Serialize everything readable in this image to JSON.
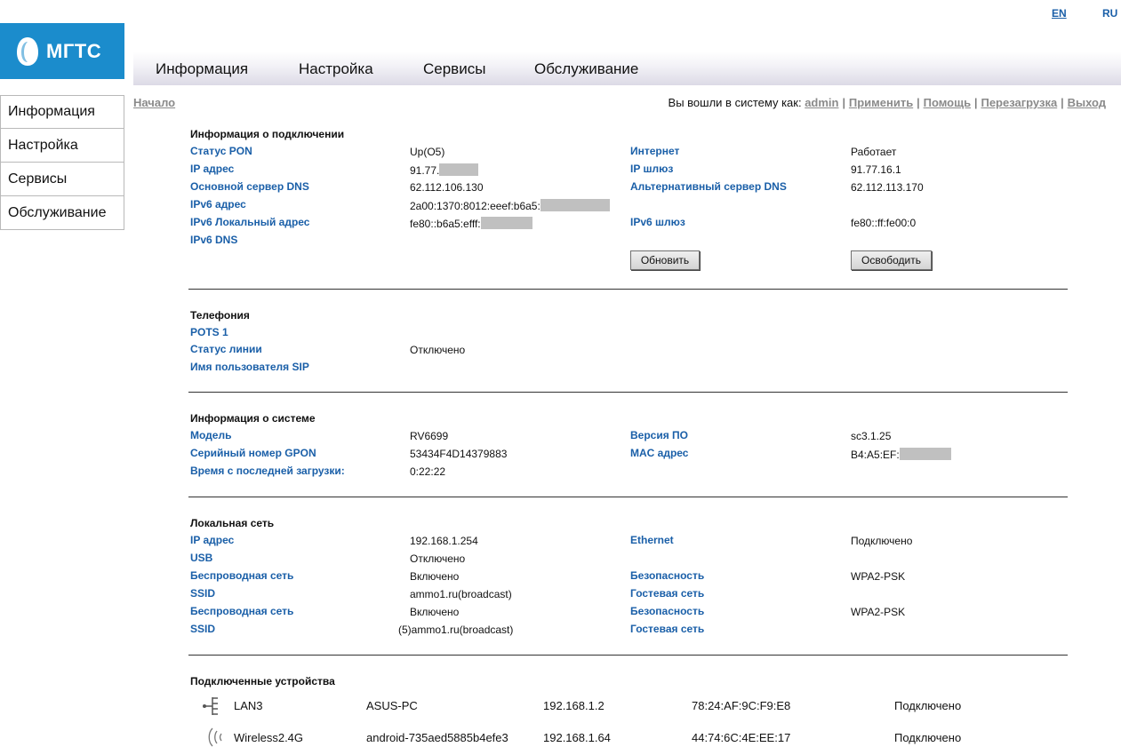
{
  "lang": {
    "en": "EN",
    "ru": "RU"
  },
  "logo": {
    "text": "МГТС",
    "color": "#1b8ccc"
  },
  "topnav": [
    "Информация",
    "Настройка",
    "Сервисы",
    "Обслуживание"
  ],
  "sidebar": [
    "Информация",
    "Настройка",
    "Сервисы",
    "Обслуживание"
  ],
  "breadcrumb": "Начало",
  "userbar": {
    "logged_in_as": "Вы вошли в систему как:",
    "user": "admin",
    "apply": "Применить",
    "help": "Помощь",
    "reboot": "Перезагрузка",
    "logout": "Выход"
  },
  "connection": {
    "title": "Информация о подключении",
    "pon_status_label": "Статус PON",
    "pon_status": "Up(O5)",
    "internet_label": "Интернет",
    "internet": "Работает",
    "ip_label": "IP адрес",
    "ip": "91.77.",
    "gateway_label": "IP шлюз",
    "gateway": "91.77.16.1",
    "dns_primary_label": "Основной сервер DNS",
    "dns_primary": "62.112.106.130",
    "dns_alt_label": "Альтернативный сервер DNS",
    "dns_alt": "62.112.113.170",
    "ipv6_label": "IPv6 адрес",
    "ipv6": "2a00:1370:8012:eeef:b6a5:",
    "ipv6_local_label": "IPv6 Локальный адрес",
    "ipv6_local": "fe80::b6a5:efff:",
    "ipv6_gw_label": "IPv6 шлюз",
    "ipv6_gw": "fe80::ff:fe00:0",
    "ipv6_dns_label": "IPv6 DNS",
    "renew_button": "Обновить",
    "release_button": "Освободить"
  },
  "telephony": {
    "title": "Телефония",
    "pots": "POTS 1",
    "line_status_label": "Статус линии",
    "line_status": "Отключено",
    "sip_user_label": "Имя пользователя SIP"
  },
  "system": {
    "title": "Информация о системе",
    "model_label": "Модель",
    "model": "RV6699",
    "firmware_label": "Версия ПО",
    "firmware": "sc3.1.25",
    "serial_label": "Серийный номер GPON",
    "serial": "53434F4D14379883",
    "mac_label": "MAC адрес",
    "mac": "B4:A5:EF:",
    "uptime_label": "Время с последней загрузки:",
    "uptime": "0:22:22"
  },
  "lan": {
    "title": "Локальная сеть",
    "ip_label": "IP адрес",
    "ip": "192.168.1.254",
    "ethernet_label": "Ethernet",
    "ethernet": "Подключено",
    "usb_label": "USB",
    "usb": "Отключено",
    "wifi1_label": "Беспроводная сеть",
    "wifi1": "Включено",
    "sec1_label": "Безопасность",
    "sec1": "WPA2-PSK",
    "ssid1_label": "SSID",
    "ssid1": "ammo1.ru(broadcast)",
    "guest1_label": "Гостевая сеть",
    "wifi2_label": "Беспроводная сеть",
    "wifi2": "Включено",
    "sec2_label": "Безопасность",
    "sec2": "WPA2-PSK",
    "ssid2_label": "SSID",
    "ssid2": "(5)ammo1.ru(broadcast)",
    "guest2_label": "Гостевая сеть"
  },
  "devices": {
    "title": "Подключенные устройства",
    "rows": [
      {
        "icon": "lan-port-icon",
        "port": "LAN3",
        "name": "ASUS-PC",
        "ip": "192.168.1.2",
        "mac": "78:24:AF:9C:F9:E8",
        "status": "Подключено"
      },
      {
        "icon": "wireless-icon",
        "port": "Wireless2.4G",
        "name": "android-735aed5885b4efe3",
        "ip": "192.168.1.64",
        "mac": "44:74:6C:4E:EE:17",
        "status": "Подключено"
      }
    ]
  }
}
